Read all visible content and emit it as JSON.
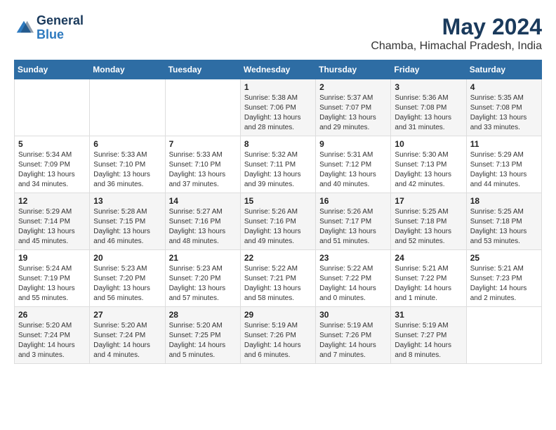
{
  "header": {
    "logo_line1": "General",
    "logo_line2": "Blue",
    "main_title": "May 2024",
    "subtitle": "Chamba, Himachal Pradesh, India"
  },
  "weekdays": [
    "Sunday",
    "Monday",
    "Tuesday",
    "Wednesday",
    "Thursday",
    "Friday",
    "Saturday"
  ],
  "weeks": [
    [
      {
        "day": "",
        "info": ""
      },
      {
        "day": "",
        "info": ""
      },
      {
        "day": "",
        "info": ""
      },
      {
        "day": "1",
        "info": "Sunrise: 5:38 AM\nSunset: 7:06 PM\nDaylight: 13 hours\nand 28 minutes."
      },
      {
        "day": "2",
        "info": "Sunrise: 5:37 AM\nSunset: 7:07 PM\nDaylight: 13 hours\nand 29 minutes."
      },
      {
        "day": "3",
        "info": "Sunrise: 5:36 AM\nSunset: 7:08 PM\nDaylight: 13 hours\nand 31 minutes."
      },
      {
        "day": "4",
        "info": "Sunrise: 5:35 AM\nSunset: 7:08 PM\nDaylight: 13 hours\nand 33 minutes."
      }
    ],
    [
      {
        "day": "5",
        "info": "Sunrise: 5:34 AM\nSunset: 7:09 PM\nDaylight: 13 hours\nand 34 minutes."
      },
      {
        "day": "6",
        "info": "Sunrise: 5:33 AM\nSunset: 7:10 PM\nDaylight: 13 hours\nand 36 minutes."
      },
      {
        "day": "7",
        "info": "Sunrise: 5:33 AM\nSunset: 7:10 PM\nDaylight: 13 hours\nand 37 minutes."
      },
      {
        "day": "8",
        "info": "Sunrise: 5:32 AM\nSunset: 7:11 PM\nDaylight: 13 hours\nand 39 minutes."
      },
      {
        "day": "9",
        "info": "Sunrise: 5:31 AM\nSunset: 7:12 PM\nDaylight: 13 hours\nand 40 minutes."
      },
      {
        "day": "10",
        "info": "Sunrise: 5:30 AM\nSunset: 7:13 PM\nDaylight: 13 hours\nand 42 minutes."
      },
      {
        "day": "11",
        "info": "Sunrise: 5:29 AM\nSunset: 7:13 PM\nDaylight: 13 hours\nand 44 minutes."
      }
    ],
    [
      {
        "day": "12",
        "info": "Sunrise: 5:29 AM\nSunset: 7:14 PM\nDaylight: 13 hours\nand 45 minutes."
      },
      {
        "day": "13",
        "info": "Sunrise: 5:28 AM\nSunset: 7:15 PM\nDaylight: 13 hours\nand 46 minutes."
      },
      {
        "day": "14",
        "info": "Sunrise: 5:27 AM\nSunset: 7:16 PM\nDaylight: 13 hours\nand 48 minutes."
      },
      {
        "day": "15",
        "info": "Sunrise: 5:26 AM\nSunset: 7:16 PM\nDaylight: 13 hours\nand 49 minutes."
      },
      {
        "day": "16",
        "info": "Sunrise: 5:26 AM\nSunset: 7:17 PM\nDaylight: 13 hours\nand 51 minutes."
      },
      {
        "day": "17",
        "info": "Sunrise: 5:25 AM\nSunset: 7:18 PM\nDaylight: 13 hours\nand 52 minutes."
      },
      {
        "day": "18",
        "info": "Sunrise: 5:25 AM\nSunset: 7:18 PM\nDaylight: 13 hours\nand 53 minutes."
      }
    ],
    [
      {
        "day": "19",
        "info": "Sunrise: 5:24 AM\nSunset: 7:19 PM\nDaylight: 13 hours\nand 55 minutes."
      },
      {
        "day": "20",
        "info": "Sunrise: 5:23 AM\nSunset: 7:20 PM\nDaylight: 13 hours\nand 56 minutes."
      },
      {
        "day": "21",
        "info": "Sunrise: 5:23 AM\nSunset: 7:20 PM\nDaylight: 13 hours\nand 57 minutes."
      },
      {
        "day": "22",
        "info": "Sunrise: 5:22 AM\nSunset: 7:21 PM\nDaylight: 13 hours\nand 58 minutes."
      },
      {
        "day": "23",
        "info": "Sunrise: 5:22 AM\nSunset: 7:22 PM\nDaylight: 14 hours\nand 0 minutes."
      },
      {
        "day": "24",
        "info": "Sunrise: 5:21 AM\nSunset: 7:22 PM\nDaylight: 14 hours\nand 1 minute."
      },
      {
        "day": "25",
        "info": "Sunrise: 5:21 AM\nSunset: 7:23 PM\nDaylight: 14 hours\nand 2 minutes."
      }
    ],
    [
      {
        "day": "26",
        "info": "Sunrise: 5:20 AM\nSunset: 7:24 PM\nDaylight: 14 hours\nand 3 minutes."
      },
      {
        "day": "27",
        "info": "Sunrise: 5:20 AM\nSunset: 7:24 PM\nDaylight: 14 hours\nand 4 minutes."
      },
      {
        "day": "28",
        "info": "Sunrise: 5:20 AM\nSunset: 7:25 PM\nDaylight: 14 hours\nand 5 minutes."
      },
      {
        "day": "29",
        "info": "Sunrise: 5:19 AM\nSunset: 7:26 PM\nDaylight: 14 hours\nand 6 minutes."
      },
      {
        "day": "30",
        "info": "Sunrise: 5:19 AM\nSunset: 7:26 PM\nDaylight: 14 hours\nand 7 minutes."
      },
      {
        "day": "31",
        "info": "Sunrise: 5:19 AM\nSunset: 7:27 PM\nDaylight: 14 hours\nand 8 minutes."
      },
      {
        "day": "",
        "info": ""
      }
    ]
  ]
}
